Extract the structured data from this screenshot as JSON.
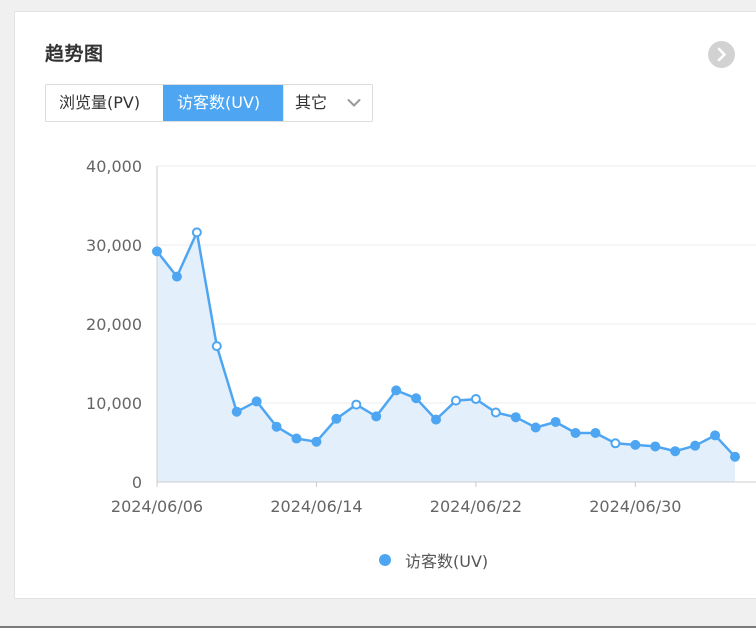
{
  "panel": {
    "title": "趋势图"
  },
  "tabs": [
    {
      "label": "浏览量(PV)",
      "active": false
    },
    {
      "label": "访客数(UV)",
      "active": true
    },
    {
      "label": "其它",
      "active": false
    }
  ],
  "icons": {
    "more": "chevron-right-circle-icon",
    "dropdown": "chevron-down-icon"
  },
  "colors": {
    "accent": "#4ea6f2",
    "area_fill": "#e3f0fc"
  },
  "chart_data": {
    "type": "area",
    "xlabel": "",
    "ylabel": "",
    "ylim": [
      0,
      40000
    ],
    "yticks": [
      "0",
      "10,000",
      "20,000",
      "30,000",
      "40,000"
    ],
    "xticks": [
      "2024/06/06",
      "2024/06/14",
      "2024/06/22",
      "2024/06/30"
    ],
    "grid": true,
    "legend_position": "bottom",
    "series": [
      {
        "name": "访客数(UV)",
        "x": [
          "2024/06/06",
          "2024/06/07",
          "2024/06/08",
          "2024/06/09",
          "2024/06/10",
          "2024/06/11",
          "2024/06/12",
          "2024/06/13",
          "2024/06/14",
          "2024/06/15",
          "2024/06/16",
          "2024/06/17",
          "2024/06/18",
          "2024/06/19",
          "2024/06/20",
          "2024/06/21",
          "2024/06/22",
          "2024/06/23",
          "2024/06/24",
          "2024/06/25",
          "2024/06/26",
          "2024/06/27",
          "2024/06/28",
          "2024/06/29",
          "2024/06/30",
          "2024/07/01",
          "2024/07/02",
          "2024/07/03",
          "2024/07/04",
          "2024/07/05"
        ],
        "values": [
          29200,
          26000,
          31600,
          17200,
          8900,
          10200,
          7000,
          5500,
          5100,
          8000,
          9800,
          8300,
          11600,
          10600,
          7900,
          10300,
          10500,
          8800,
          8200,
          6900,
          7600,
          6200,
          6200,
          4900,
          4700,
          4500,
          3900,
          4600,
          5900,
          3200
        ]
      }
    ]
  }
}
